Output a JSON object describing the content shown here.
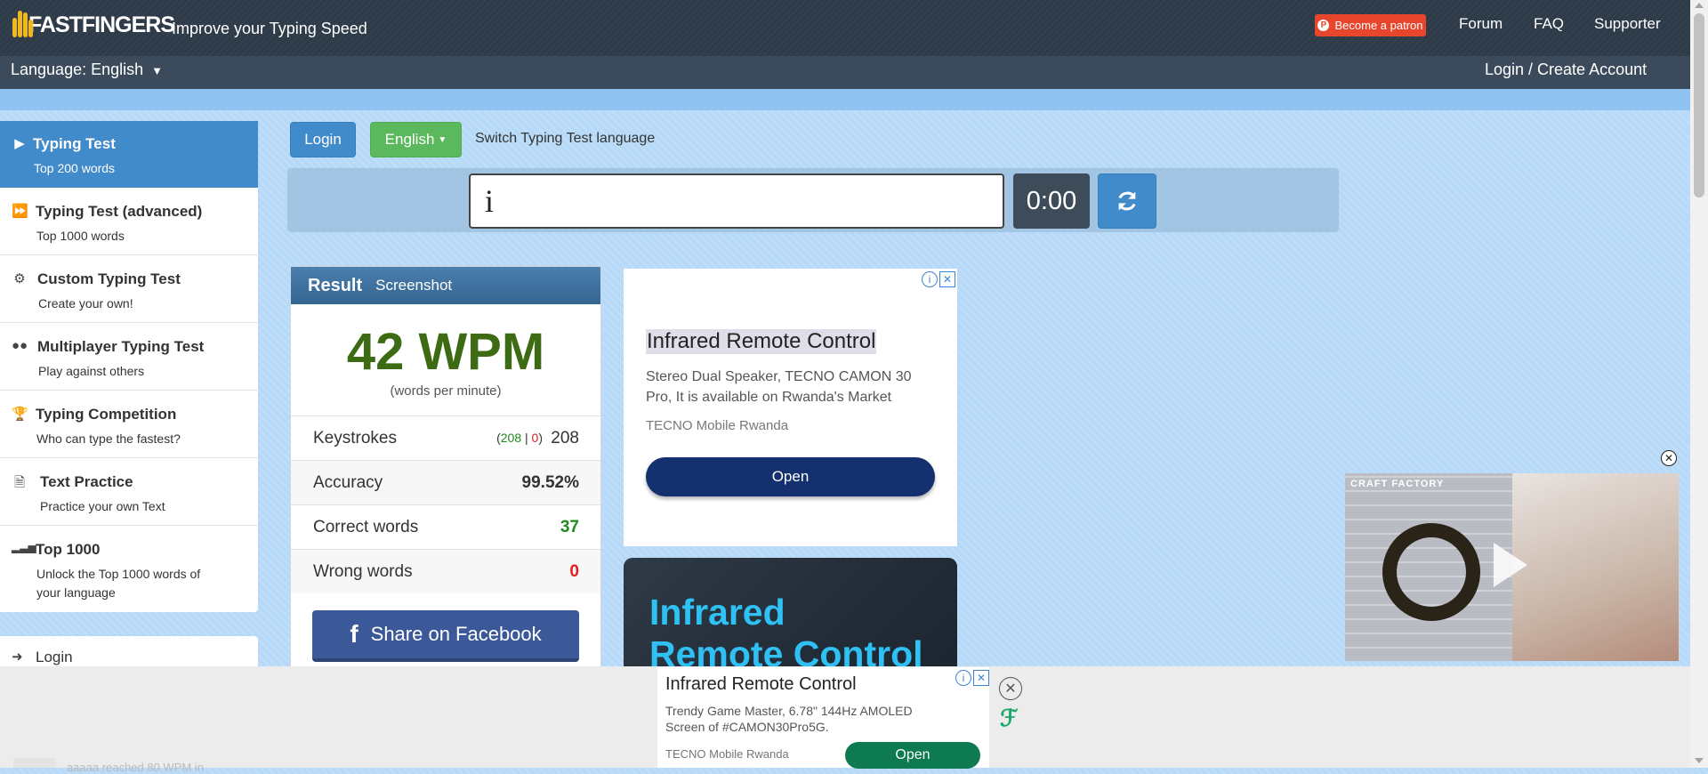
{
  "header": {
    "logo_text": "FASTFINGERS",
    "tagline": "Improve your Typing Speed",
    "patron_label": "Become a patron",
    "nav": [
      "Forum",
      "FAQ",
      "Supporter"
    ],
    "language_label": "Language: English",
    "login_create": "Login / Create Account"
  },
  "sidebar": {
    "items": [
      {
        "title": "Typing Test",
        "subtitle": "Top 200 words",
        "icon": "play-icon"
      },
      {
        "title": "Typing Test (advanced)",
        "subtitle": "Top 1000 words",
        "icon": "fast-forward-icon"
      },
      {
        "title": "Custom Typing Test",
        "subtitle": "Create your own!",
        "icon": "gears-icon"
      },
      {
        "title": "Multiplayer Typing Test",
        "subtitle": "Play against others",
        "icon": "users-icon"
      },
      {
        "title": "Typing Competition",
        "subtitle": "Who can type the fastest?",
        "icon": "trophy-icon"
      },
      {
        "title": "Text Practice",
        "subtitle": "Practice your own Text",
        "icon": "document-icon"
      },
      {
        "title": "Top 1000",
        "subtitle": "Unlock the Top 1000 words of your language",
        "icon": "signal-icon"
      }
    ],
    "login_label": "Login"
  },
  "toolbar": {
    "login_label": "Login",
    "language_button": "English",
    "switch_text": "Switch Typing Test language"
  },
  "typing": {
    "input_value": "i",
    "timer": "0:00"
  },
  "result": {
    "title": "Result",
    "screenshot_label": "Screenshot",
    "wpm": "42 WPM",
    "wpm_sub": "(words per minute)",
    "keystrokes_label": "Keystrokes",
    "keystrokes_correct": "208",
    "keystrokes_wrong": "0",
    "keystrokes_total": "208",
    "accuracy_label": "Accuracy",
    "accuracy_value": "99.52%",
    "correct_label": "Correct words",
    "correct_value": "37",
    "wrong_label": "Wrong words",
    "wrong_value": "0",
    "facebook_label": "Share on Facebook"
  },
  "ad1": {
    "heading": "Infrared Remote Control",
    "description": "Stereo Dual Speaker, TECNO CAMON 30 Pro, It is available on Rwanda's Market",
    "source": "TECNO Mobile Rwanda",
    "button": "Open"
  },
  "ad2": {
    "line1": "Infrared",
    "line2": "Remote Control"
  },
  "video": {
    "caption": "CRAFT FACTORY"
  },
  "bottom_ad": {
    "heading": "Infrared Remote Control",
    "description": "Trendy Game Master, 6.78\" 144Hz AMOLED Screen of #CAMON30Pro5G.",
    "source": "TECNO Mobile Rwanda",
    "button": "Open"
  },
  "obscured_text": "aaaaa reached 80 WPM in",
  "colors": {
    "background": "#b7d9f8",
    "header": "#2d3a48",
    "primary": "#428bca",
    "success": "#5cb85c",
    "wpm_green": "#3d6b14",
    "facebook": "#3b5998",
    "correct_green": "#1f8a1f",
    "wrong_red": "#e11d1d"
  }
}
